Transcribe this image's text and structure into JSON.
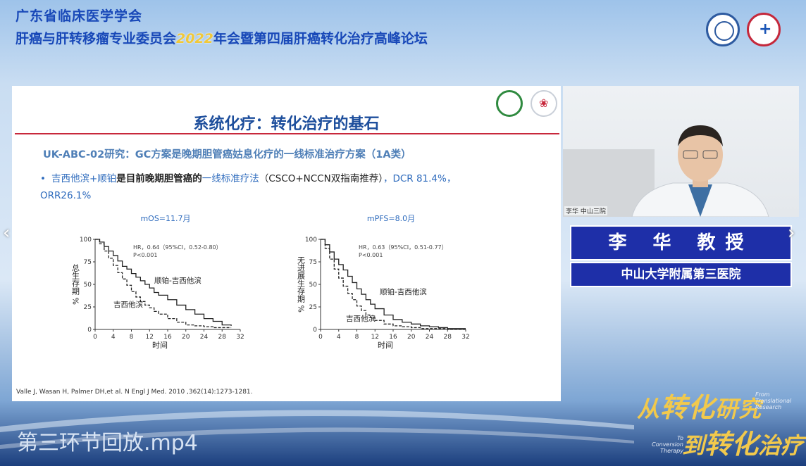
{
  "header": {
    "line1": "广东省临床医学学会",
    "line2_pre": "肝癌与肝转移瘤专业委员会",
    "line2_year": "2022",
    "line2_post": "年会暨第四届肝癌转化治疗高峰论坛"
  },
  "slide": {
    "title": "系统化疗：转化治疗的基石",
    "subtitle": "UK-ABC-02研究：GC方案是晚期胆管癌姑息化疗的一线标准治疗方案（1A类）",
    "bullet_a": "吉西他滨+顺铂",
    "bullet_b": "是目前晚期胆管癌的",
    "bullet_c": "一线标准疗法",
    "bullet_d": "（CSCO+NCCN双指南推荐）",
    "bullet_e": "，DCR 81.4%， ORR26.1%",
    "citation": "Valle J, Wasan H, Palmer DH,et al. N Engl J Med. 2010 ,362(14):1273-1281."
  },
  "chart_data": [
    {
      "type": "line",
      "title": "mOS=11.7月",
      "xlabel": "时间",
      "ylabel": "总生存期 %",
      "xlim": [
        0,
        32
      ],
      "ylim": [
        0,
        100
      ],
      "xticks": [
        0,
        4,
        8,
        12,
        16,
        20,
        24,
        28,
        32
      ],
      "yticks": [
        0,
        25,
        50,
        75,
        100
      ],
      "annotation": [
        "HR，0.64（95%CI，0.52-0.80）",
        "P<0.001"
      ],
      "series": [
        {
          "name": "顺铂-吉西他滨",
          "style": "solid",
          "x": [
            0,
            1,
            2,
            3,
            4,
            5,
            6,
            7,
            8,
            9,
            10,
            11,
            12,
            13,
            14,
            16,
            18,
            20,
            22,
            24,
            26,
            28,
            30
          ],
          "y": [
            100,
            97,
            92,
            87,
            82,
            76,
            70,
            67,
            62,
            58,
            54,
            50,
            46,
            41,
            38,
            33,
            27,
            22,
            17,
            12,
            9,
            5,
            4
          ]
        },
        {
          "name": "吉西他滨",
          "style": "dashed",
          "x": [
            0,
            1,
            2,
            3,
            4,
            5,
            6,
            7,
            8,
            9,
            10,
            11,
            12,
            13,
            14,
            16,
            18,
            20,
            22,
            24,
            26,
            28,
            30
          ],
          "y": [
            100,
            95,
            87,
            79,
            71,
            63,
            56,
            49,
            42,
            36,
            31,
            27,
            24,
            20,
            17,
            12,
            8,
            5,
            4,
            3,
            2,
            2,
            2
          ]
        }
      ]
    },
    {
      "type": "line",
      "title": "mPFS=8.0月",
      "xlabel": "时间",
      "ylabel": "无进展生存期 %",
      "xlim": [
        0,
        32
      ],
      "ylim": [
        0,
        100
      ],
      "xticks": [
        0,
        4,
        8,
        12,
        16,
        20,
        24,
        28,
        32
      ],
      "yticks": [
        0,
        25,
        50,
        75,
        100
      ],
      "annotation": [
        "HR，0.63（95%CI，0.51-0.77）",
        "P<0.001"
      ],
      "series": [
        {
          "name": "顺铂-吉西他滨",
          "style": "solid",
          "x": [
            0,
            1,
            2,
            3,
            4,
            5,
            6,
            7,
            8,
            9,
            10,
            11,
            12,
            14,
            16,
            18,
            20,
            22,
            24,
            26,
            28,
            30,
            32
          ],
          "y": [
            100,
            94,
            86,
            78,
            72,
            66,
            59,
            52,
            45,
            39,
            33,
            28,
            23,
            16,
            11,
            8,
            6,
            4,
            3,
            2,
            1,
            1,
            1
          ]
        },
        {
          "name": "吉西他滨",
          "style": "dashed",
          "x": [
            0,
            1,
            2,
            3,
            4,
            5,
            6,
            7,
            8,
            9,
            10,
            11,
            12,
            14,
            16,
            18,
            20,
            22,
            24,
            26,
            28,
            30,
            32
          ],
          "y": [
            100,
            90,
            78,
            67,
            57,
            48,
            40,
            33,
            26,
            21,
            16,
            13,
            10,
            6,
            4,
            3,
            2,
            1,
            1,
            1,
            0,
            0,
            0
          ]
        }
      ]
    }
  ],
  "presenter": {
    "name": "李 华 教授",
    "hospital": "中山大学附属第三医院",
    "cam_label": "李华 中山三院"
  },
  "player": {
    "filename": "第三环节回放.mp4",
    "prev_icon": "chevron-left-icon",
    "next_icon": "chevron-right-icon"
  },
  "tagline": {
    "line1_pre": "从",
    "line1_big": "转化",
    "line1_post": "研究",
    "line1_en": "From Translational Research",
    "line2_pre": "到",
    "line2_big": "转化",
    "line2_post": "治疗",
    "line2_en": "To Conversion Therapy"
  }
}
